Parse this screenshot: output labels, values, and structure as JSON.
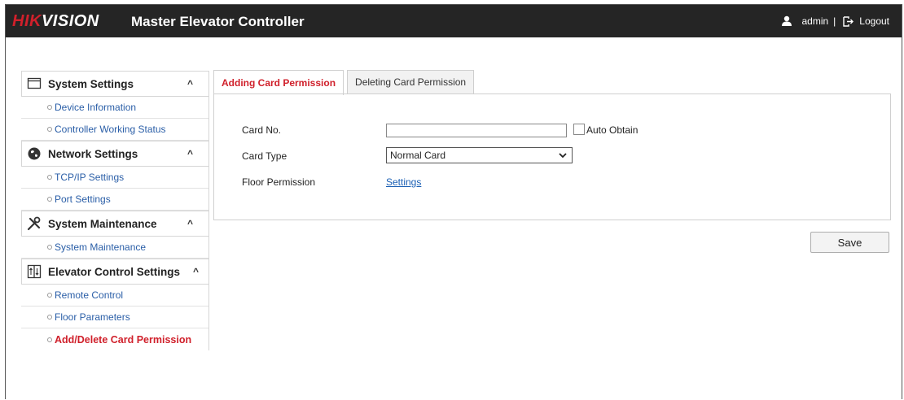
{
  "header": {
    "brand_hik": "HIK",
    "brand_vision": "VISION",
    "app_title": "Master Elevator Controller",
    "user_icon": "user-icon",
    "username": "admin",
    "separator": "|",
    "logout_icon": "logout-icon",
    "logout_label": "Logout"
  },
  "sidebar": {
    "sections": [
      {
        "label": "System Settings",
        "icon": "window-icon",
        "caret": "^",
        "items": [
          {
            "label": "Device Information"
          },
          {
            "label": "Controller Working Status"
          }
        ]
      },
      {
        "label": "Network Settings",
        "icon": "globe-icon",
        "caret": "^",
        "items": [
          {
            "label": "TCP/IP Settings"
          },
          {
            "label": "Port Settings"
          }
        ]
      },
      {
        "label": "System Maintenance",
        "icon": "tools-icon",
        "caret": "^",
        "items": [
          {
            "label": "System Maintenance"
          }
        ]
      },
      {
        "label": "Elevator Control Settings",
        "icon": "elevator-icon",
        "caret": "^",
        "items": [
          {
            "label": "Remote Control"
          },
          {
            "label": "Floor Parameters"
          },
          {
            "label": "Add/Delete Card Permission",
            "active": true
          }
        ]
      }
    ]
  },
  "tabs": [
    {
      "label": "Adding Card Permission",
      "active": true
    },
    {
      "label": "Deleting Card Permission",
      "active": false
    }
  ],
  "form": {
    "card_no_label": "Card No.",
    "card_no_value": "",
    "auto_obtain_label": "Auto Obtain",
    "auto_obtain_checked": false,
    "card_type_label": "Card Type",
    "card_type_value": "Normal Card",
    "floor_permission_label": "Floor Permission",
    "floor_permission_link": "Settings"
  },
  "actions": {
    "save_label": "Save"
  },
  "colors": {
    "accent_red": "#d0202b",
    "topbar_bg": "#252525",
    "link_blue": "#1a5fb4"
  }
}
